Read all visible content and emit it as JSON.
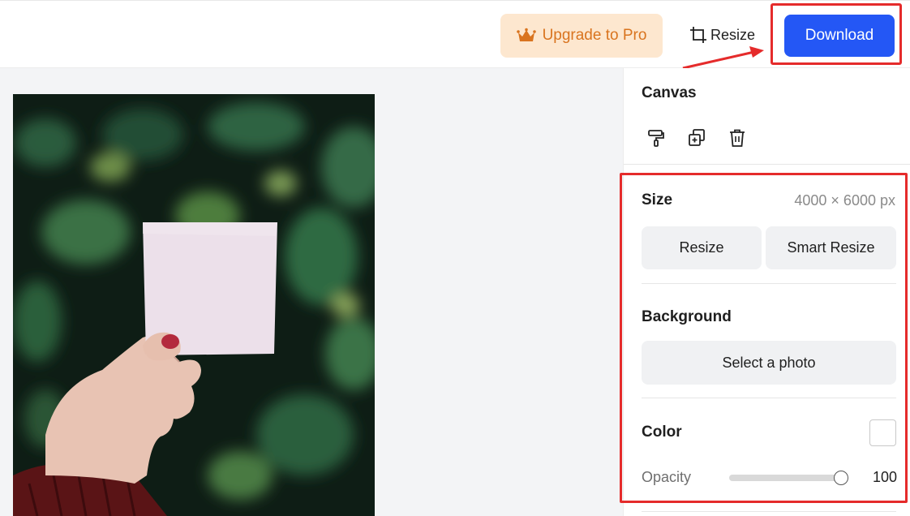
{
  "header": {
    "upgrade_label": "Upgrade to Pro",
    "upgrade_icon": "crown-icon",
    "resize_label": "Resize",
    "resize_icon": "crop-icon",
    "download_label": "Download"
  },
  "colors": {
    "primary": "#2457f5",
    "upgrade_bg": "#fde7cf",
    "upgrade_text": "#d9741f",
    "highlight": "#e52b2b",
    "workspace_bg": "#f3f4f6"
  },
  "panel": {
    "title": "Canvas",
    "tools": [
      {
        "icon": "paint-roller-icon"
      },
      {
        "icon": "duplicate-icon"
      },
      {
        "icon": "trash-icon"
      }
    ],
    "size": {
      "label": "Size",
      "value": "4000 × 6000 px",
      "resize_button": "Resize",
      "smart_resize_button": "Smart Resize"
    },
    "background": {
      "label": "Background",
      "select_button": "Select a photo"
    },
    "color": {
      "label": "Color",
      "swatch": "#ffffff"
    },
    "opacity": {
      "label": "Opacity",
      "value": "100",
      "level": 1.0
    }
  }
}
